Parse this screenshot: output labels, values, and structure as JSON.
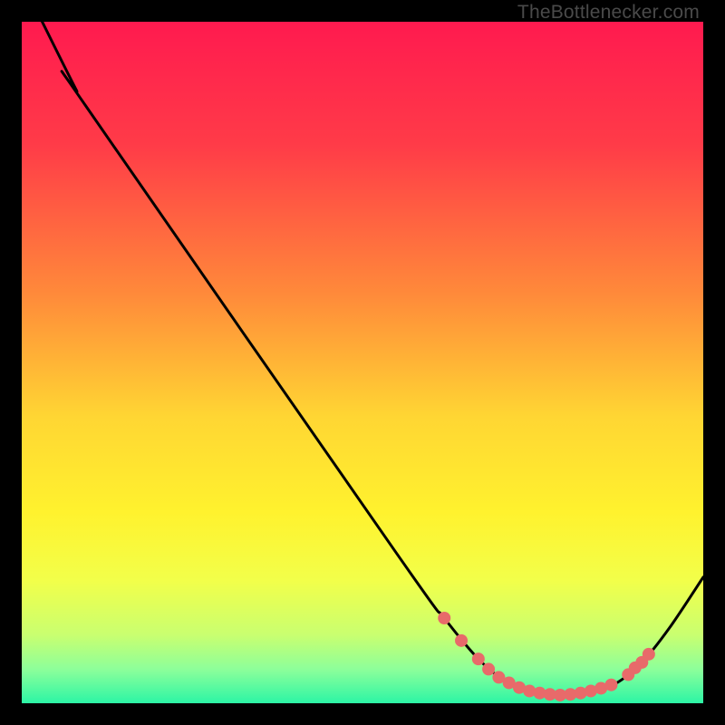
{
  "watermark": "TheBottlenecker.com",
  "chart_data": {
    "type": "line",
    "title": "",
    "xlabel": "",
    "ylabel": "",
    "xlim": [
      0,
      100
    ],
    "ylim": [
      0,
      100
    ],
    "gradient_stops": [
      {
        "offset": 0,
        "color": "#ff1a4f"
      },
      {
        "offset": 18,
        "color": "#ff3b48"
      },
      {
        "offset": 40,
        "color": "#ff8a3a"
      },
      {
        "offset": 58,
        "color": "#ffd633"
      },
      {
        "offset": 72,
        "color": "#fff22e"
      },
      {
        "offset": 82,
        "color": "#f2ff4a"
      },
      {
        "offset": 90,
        "color": "#c9ff70"
      },
      {
        "offset": 95,
        "color": "#8dff9a"
      },
      {
        "offset": 100,
        "color": "#2cf5a5"
      }
    ],
    "series": [
      {
        "name": "bottleneck-curve",
        "color": "#000000",
        "points": [
          {
            "x": 3.0,
            "y": 100.0
          },
          {
            "x": 8.0,
            "y": 90.0
          },
          {
            "x": 9.5,
            "y": 87.5
          },
          {
            "x": 55.0,
            "y": 22.0
          },
          {
            "x": 62.0,
            "y": 12.5
          },
          {
            "x": 67.0,
            "y": 6.5
          },
          {
            "x": 71.0,
            "y": 3.2
          },
          {
            "x": 75.0,
            "y": 1.6
          },
          {
            "x": 79.0,
            "y": 1.2
          },
          {
            "x": 83.0,
            "y": 1.5
          },
          {
            "x": 87.0,
            "y": 2.8
          },
          {
            "x": 91.0,
            "y": 6.0
          },
          {
            "x": 95.0,
            "y": 11.0
          },
          {
            "x": 100.0,
            "y": 18.5
          }
        ]
      }
    ],
    "markers": {
      "name": "data-points",
      "color": "#e86a6a",
      "radius": 7,
      "points": [
        {
          "x": 62.0,
          "y": 12.5
        },
        {
          "x": 64.5,
          "y": 9.2
        },
        {
          "x": 67.0,
          "y": 6.5
        },
        {
          "x": 68.5,
          "y": 5.0
        },
        {
          "x": 70.0,
          "y": 3.8
        },
        {
          "x": 71.5,
          "y": 3.0
        },
        {
          "x": 73.0,
          "y": 2.3
        },
        {
          "x": 74.5,
          "y": 1.8
        },
        {
          "x": 76.0,
          "y": 1.5
        },
        {
          "x": 77.5,
          "y": 1.3
        },
        {
          "x": 79.0,
          "y": 1.2
        },
        {
          "x": 80.5,
          "y": 1.3
        },
        {
          "x": 82.0,
          "y": 1.5
        },
        {
          "x": 83.5,
          "y": 1.8
        },
        {
          "x": 85.0,
          "y": 2.2
        },
        {
          "x": 86.5,
          "y": 2.7
        },
        {
          "x": 89.0,
          "y": 4.2
        },
        {
          "x": 90.0,
          "y": 5.2
        },
        {
          "x": 91.0,
          "y": 6.0
        },
        {
          "x": 92.0,
          "y": 7.2
        }
      ]
    }
  }
}
